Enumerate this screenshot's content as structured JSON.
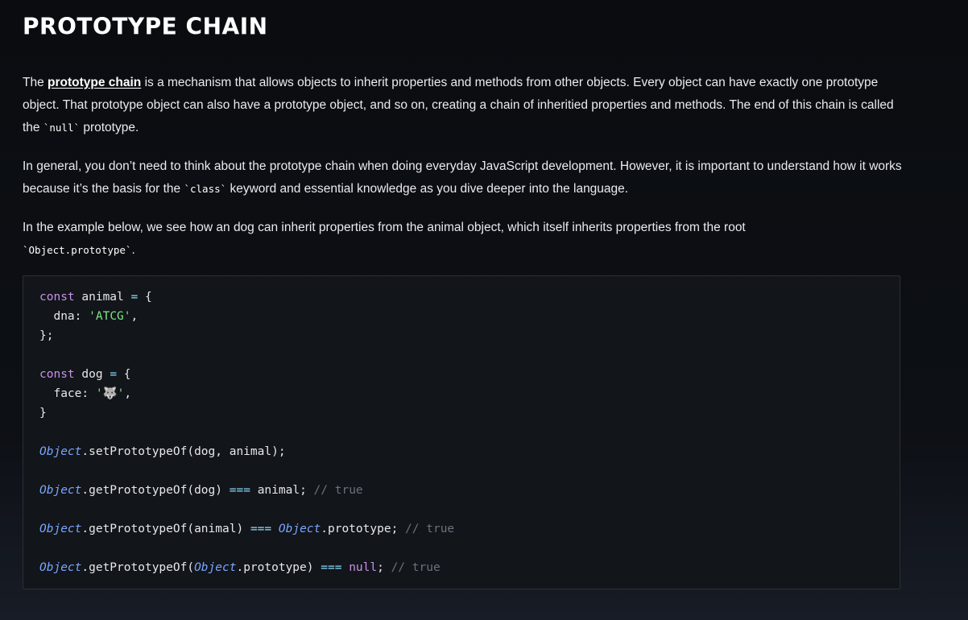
{
  "page": {
    "title": "PROTOTYPE CHAIN"
  },
  "paragraphs": {
    "p1": {
      "before_link": "The ",
      "link": "prototype chain",
      "after_link": " is a mechanism that allows objects to inherit properties and methods from other objects. Every object can have exactly one prototype object. That prototype object can also have a prototype object, and so on, creating a chain of inheritied properties and methods. The end of this chain is called the ",
      "code": "`null`",
      "end": " prototype."
    },
    "p2": {
      "before_code": "In general, you don’t need to think about the prototype chain when doing everyday JavaScript development. However, it is important to understand how it works because it’s the basis for the ",
      "code": "`class`",
      "after_code": " keyword and essential knowledge as you dive deeper into the language."
    },
    "p3": {
      "text": "In the example below, we see how an dog can inherit properties from the animal object, which itself inherits properties from the root ",
      "code": "`Object.prototype`",
      "end": "."
    }
  },
  "code": {
    "const": "const",
    "animal": "animal",
    "dog": "dog",
    "eq": "=",
    "open_brace": "{",
    "dna_key": "dna",
    "dna_value": "'ATCG'",
    "close_semi": "};",
    "close": "}",
    "face_key": "face",
    "face_value": "'🐺'",
    "Object": "Object",
    "setProto": ".setPrototypeOf(dog, animal);",
    "getProto": ".getPrototypeOf",
    "strict_eq": "===",
    "comment": "// true",
    "prototype": ".prototype",
    "null": "null"
  }
}
